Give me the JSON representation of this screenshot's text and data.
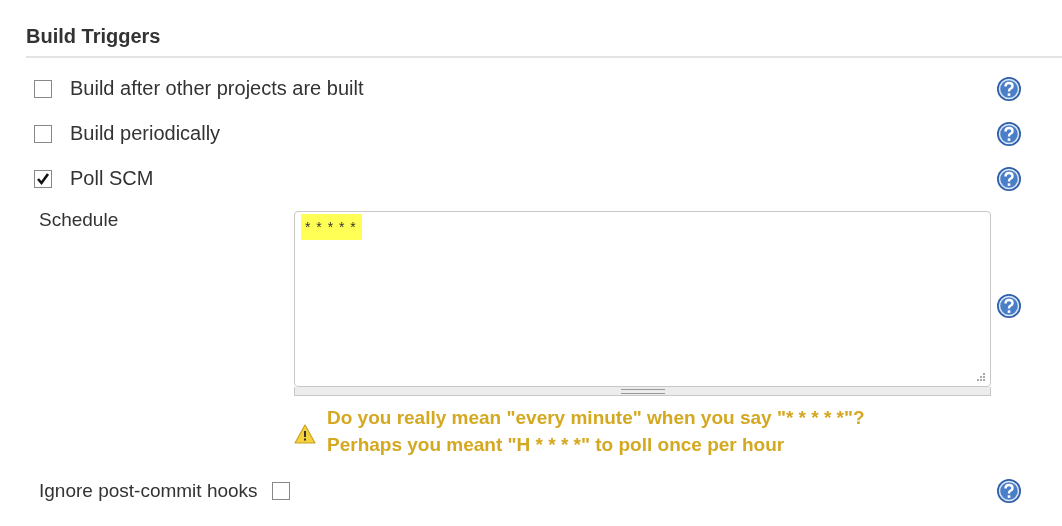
{
  "section": {
    "title": "Build Triggers"
  },
  "triggers": [
    {
      "label": "Build after other projects are built",
      "checked": false
    },
    {
      "label": "Build periodically",
      "checked": false
    },
    {
      "label": "Poll SCM",
      "checked": true
    }
  ],
  "schedule": {
    "label": "Schedule",
    "value": "* * * * *",
    "warning": [
      "Do you really mean \"every minute\" when you say \"* * * * *\"?",
      "Perhaps you meant \"H * * * *\" to poll once per hour"
    ]
  },
  "ignore_hooks": {
    "label": "Ignore post-commit hooks",
    "checked": false
  }
}
